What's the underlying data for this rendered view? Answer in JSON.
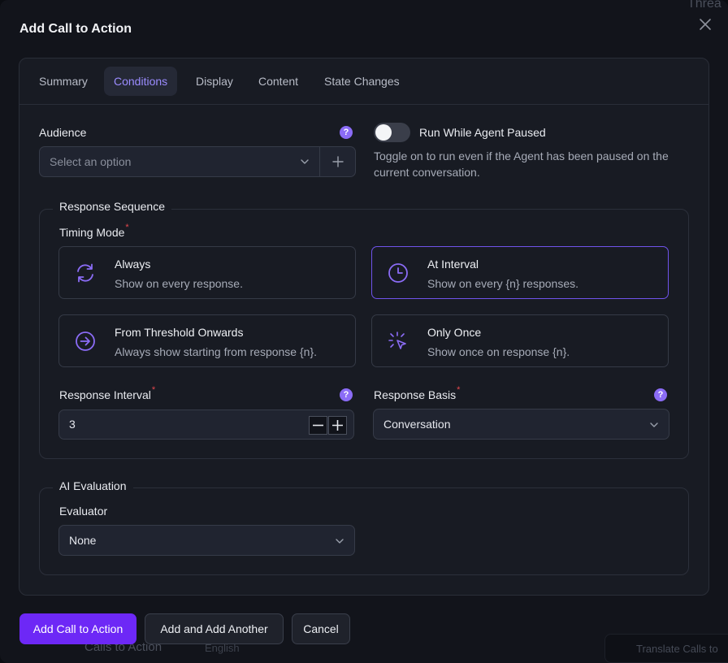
{
  "background": {
    "threads_label": "Threa",
    "calls_to_action_label": "Calls to Action",
    "english_label": "English",
    "translate_label": "Translate Calls to"
  },
  "modal": {
    "title": "Add Call to Action"
  },
  "tabs": [
    {
      "label": "Summary",
      "active": false
    },
    {
      "label": "Conditions",
      "active": true
    },
    {
      "label": "Display",
      "active": false
    },
    {
      "label": "Content",
      "active": false
    },
    {
      "label": "State Changes",
      "active": false
    }
  ],
  "audience": {
    "label": "Audience",
    "placeholder": "Select an option"
  },
  "run_while_paused": {
    "label": "Run While Agent Paused",
    "enabled": false,
    "description": "Toggle on to run even if the Agent has been paused on the current conversation."
  },
  "response_sequence": {
    "legend": "Response Sequence",
    "timing_mode_label": "Timing Mode",
    "required_mark": "*",
    "options": [
      {
        "title": "Always",
        "desc": "Show on every response.",
        "icon": "refresh-icon",
        "selected": false
      },
      {
        "title": "At Interval",
        "desc": "Show on every {n} responses.",
        "icon": "clock-icon",
        "selected": true
      },
      {
        "title": "From Threshold Onwards",
        "desc": "Always show starting from response {n}.",
        "icon": "arrow-right-circle-icon",
        "selected": false
      },
      {
        "title": "Only Once",
        "desc": "Show once on response {n}.",
        "icon": "click-pointer-icon",
        "selected": false
      }
    ],
    "interval_label": "Response Interval",
    "interval_value": "3",
    "basis_label": "Response Basis",
    "basis_value": "Conversation"
  },
  "ai_evaluation": {
    "legend": "AI Evaluation",
    "evaluator_label": "Evaluator",
    "evaluator_value": "None"
  },
  "help_glyph": "?",
  "buttons": {
    "primary": "Add Call to Action",
    "add_another": "Add and Add Another",
    "cancel": "Cancel"
  },
  "colors": {
    "accent": "#8b6cf6",
    "primary_button": "#6d28f6",
    "selected_border": "#6f53ea",
    "required": "#e5484d"
  }
}
